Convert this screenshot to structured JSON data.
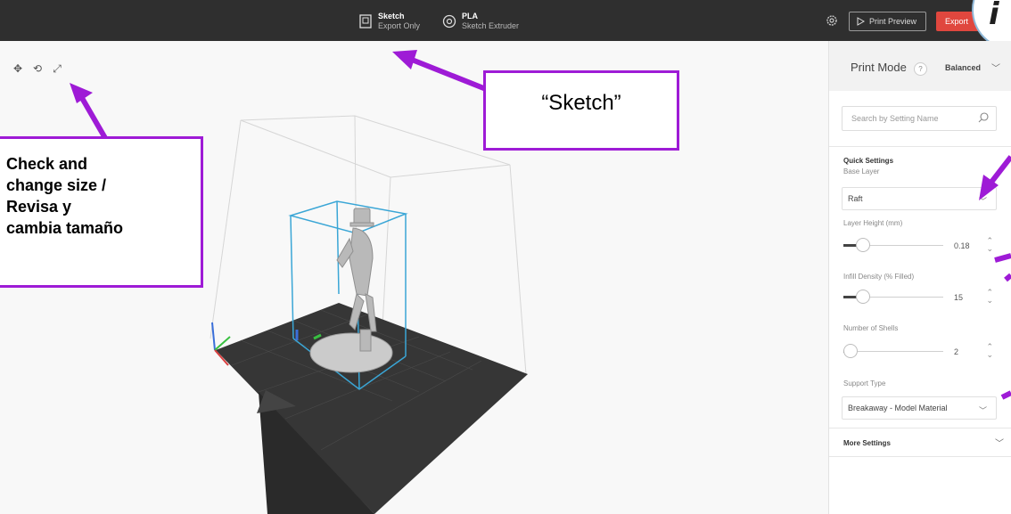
{
  "topbar": {
    "printer": {
      "title": "Sketch",
      "subtitle": "Export Only",
      "icon": "printer-icon"
    },
    "material": {
      "title": "PLA",
      "subtitle": "Sketch Extruder",
      "icon": "extruder-icon"
    },
    "settings_icon": "gear-icon",
    "preview_label": "Print Preview",
    "export_label": "Export",
    "logo_text": "i"
  },
  "viewport": {
    "tools": [
      "move-icon",
      "rotate-icon",
      "scale-icon"
    ]
  },
  "panel": {
    "print_mode_label": "Print Mode",
    "help_glyph": "?",
    "print_mode_value": "Balanced",
    "search_placeholder": "Search by Setting Name",
    "quick_settings_label": "Quick Settings",
    "base_layer_label": "Base Layer",
    "base_layer_value": "Raft",
    "layer_height_label": "Layer Height (mm)",
    "layer_height_value": "0.18",
    "layer_height_fraction": 0.15,
    "infill_label": "Infill Density (% Filled)",
    "infill_value": "15",
    "infill_fraction": 0.15,
    "shells_label": "Number of Shells",
    "shells_value": "2",
    "shells_fraction": 0.0,
    "support_label": "Support Type",
    "support_value": "Breakaway - Model Material",
    "more_settings_label": "More Settings"
  },
  "annotations": {
    "size_note": [
      "Check and",
      "change size /",
      "Revisa y",
      "cambia tamaño"
    ],
    "sketch_note": "“Sketch”"
  },
  "colors": {
    "topbar": "#2f2f2f",
    "accent_export": "#e0473e",
    "annotation": "#9e1bd6",
    "bounding_box": "#3aa6d6"
  }
}
